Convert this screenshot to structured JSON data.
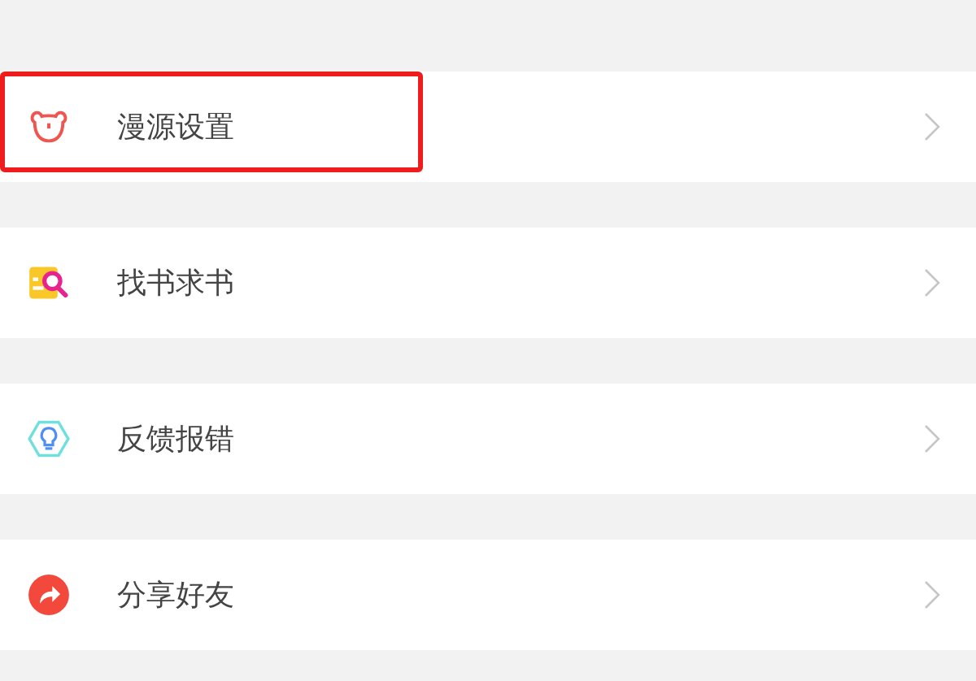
{
  "menu_items": [
    {
      "kind": "bear",
      "label": "漫源设置",
      "highlighted": true
    },
    {
      "kind": "book-search",
      "label": "找书求书",
      "highlighted": false
    },
    {
      "kind": "bulb",
      "label": "反馈报错",
      "highlighted": false
    },
    {
      "kind": "share",
      "label": "分享好友",
      "highlighted": false
    }
  ]
}
